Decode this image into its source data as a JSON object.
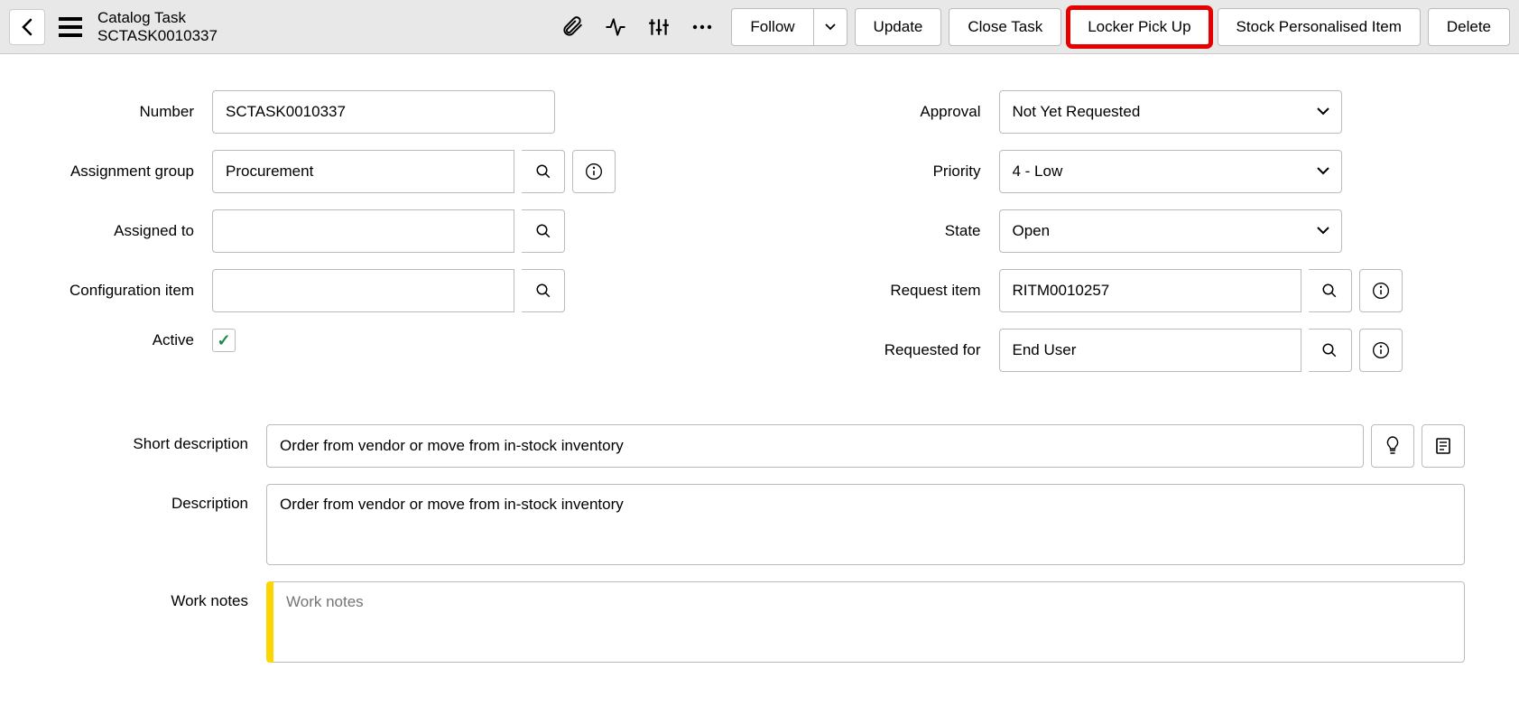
{
  "header": {
    "title": "Catalog Task",
    "record_id": "SCTASK0010337",
    "buttons": {
      "follow": "Follow",
      "update": "Update",
      "close_task": "Close Task",
      "locker_pick_up": "Locker Pick Up",
      "stock_personalised_item": "Stock Personalised Item",
      "delete": "Delete"
    }
  },
  "labels": {
    "number": "Number",
    "assignment_group": "Assignment group",
    "assigned_to": "Assigned to",
    "configuration_item": "Configuration item",
    "active": "Active",
    "approval": "Approval",
    "priority": "Priority",
    "state": "State",
    "request_item": "Request item",
    "requested_for": "Requested for",
    "short_description": "Short description",
    "description": "Description",
    "work_notes": "Work notes"
  },
  "fields": {
    "number": "SCTASK0010337",
    "assignment_group": "Procurement",
    "assigned_to": "",
    "configuration_item": "",
    "active": true,
    "approval": "Not Yet Requested",
    "priority": "4 - Low",
    "state": "Open",
    "request_item": "RITM0010257",
    "requested_for": "End User",
    "short_description": "Order from vendor or move from in-stock inventory",
    "description": "Order from vendor or move from in-stock inventory",
    "work_notes_placeholder": "Work notes"
  }
}
